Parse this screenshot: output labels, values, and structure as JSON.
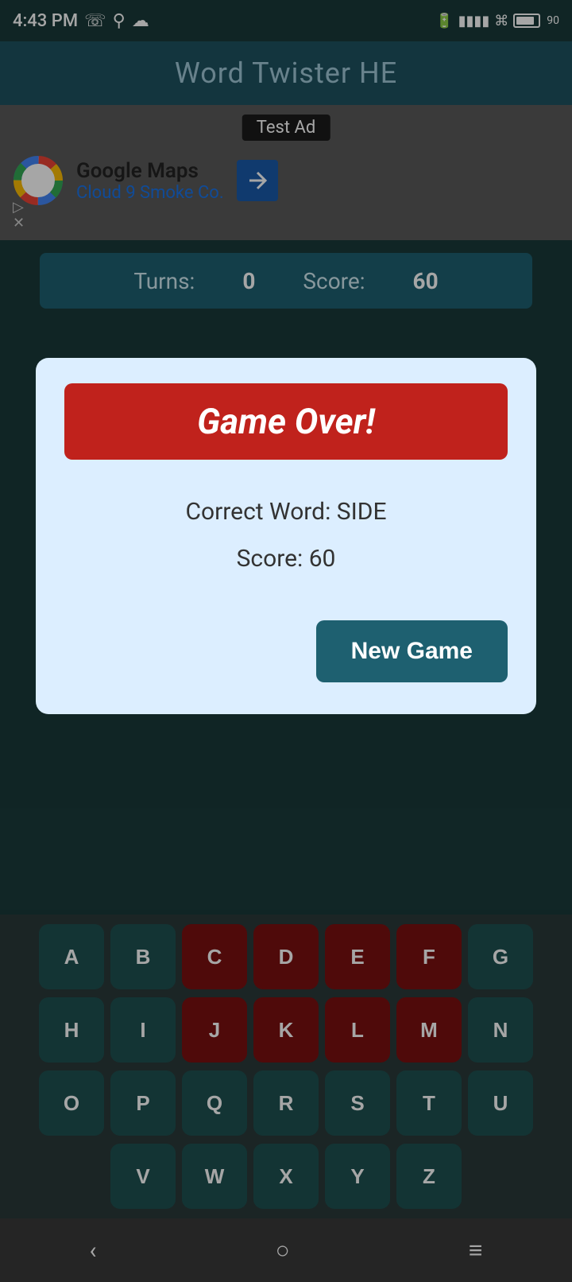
{
  "statusBar": {
    "time": "4:43 PM",
    "battery": "90"
  },
  "titleBar": {
    "title": "Word Twister HE"
  },
  "ad": {
    "testAdLabel": "Test Ad",
    "company": "Google Maps",
    "subtitle": "Cloud 9 Smoke Co."
  },
  "gameBar": {
    "turnsLabel": "Turns:",
    "turnsValue": "0",
    "scoreLabel": "Score:",
    "scoreValue": "60"
  },
  "modal": {
    "gameOverText": "Game Over!",
    "correctWordLabel": "Correct Word: SIDE",
    "scoreLine": "Score: 60",
    "newGameButton": "New Game"
  },
  "keyboard": {
    "rows": [
      [
        "A",
        "B",
        "C",
        "D",
        "E",
        "F",
        "G"
      ],
      [
        "H",
        "I",
        "J",
        "K",
        "L",
        "M",
        "N"
      ],
      [
        "O",
        "P",
        "Q",
        "R",
        "S",
        "T",
        "U"
      ],
      [
        "V",
        "W",
        "X",
        "Y",
        "Z"
      ]
    ],
    "usedKeys": [
      "C",
      "D",
      "E",
      "F",
      "J",
      "K",
      "L",
      "M"
    ]
  },
  "nav": {
    "backIcon": "‹",
    "homeIcon": "○",
    "menuIcon": "≡"
  }
}
